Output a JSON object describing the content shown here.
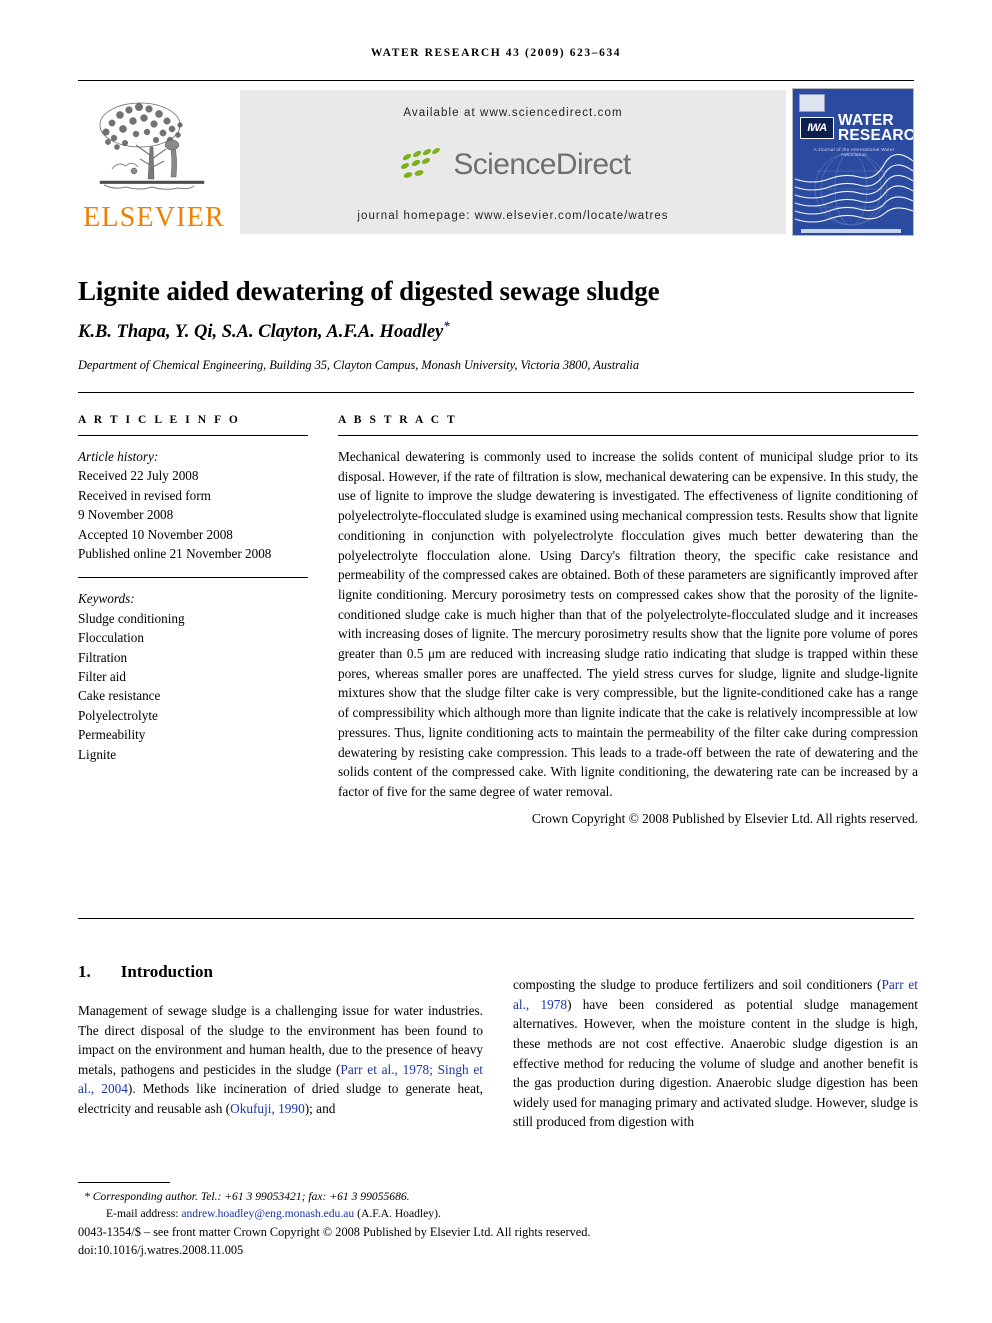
{
  "running_head": "WATER RESEARCH 43 (2009) 623–634",
  "masthead": {
    "elsevier_wordmark": "ELSEVIER",
    "available_at": "Available at www.sciencedirect.com",
    "sciencedirect_wordmark": "ScienceDirect",
    "journal_homepage": "journal homepage: www.elsevier.com/locate/watres",
    "cover": {
      "iwa_logo_text": "IWA",
      "title_line1": "WATER",
      "title_line2": "RESEARCH",
      "tagline": "A Journal of the International Water Association"
    },
    "colors": {
      "elsevier_orange": "#f08000",
      "sciencedirect_green": "#7ab317",
      "sciencedirect_gray": "#6f6f6f",
      "cover_blue": "#2b4ba0"
    }
  },
  "article": {
    "title": "Lignite aided dewatering of digested sewage sludge",
    "authors": "K.B. Thapa, Y. Qi, S.A. Clayton, A.F.A. Hoadley",
    "corresponding_marker": "*",
    "affiliation": "Department of Chemical Engineering, Building 35, Clayton Campus, Monash University, Victoria 3800, Australia"
  },
  "article_info": {
    "heading": "A R T I C L E   I N F O",
    "history_label": "Article history:",
    "history": [
      "Received 22 July 2008",
      "Received in revised form",
      "9 November 2008",
      "Accepted 10 November 2008",
      "Published online 21 November 2008"
    ],
    "keywords_label": "Keywords:",
    "keywords": [
      "Sludge conditioning",
      "Flocculation",
      "Filtration",
      "Filter aid",
      "Cake resistance",
      "Polyelectrolyte",
      "Permeability",
      "Lignite"
    ]
  },
  "abstract": {
    "heading": "A B S T R A C T",
    "text": "Mechanical dewatering is commonly used to increase the solids content of municipal sludge prior to its disposal. However, if the rate of filtration is slow, mechanical dewatering can be expensive. In this study, the use of lignite to improve the sludge dewatering is investigated. The effectiveness of lignite conditioning of polyelectrolyte-flocculated sludge is examined using mechanical compression tests. Results show that lignite conditioning in conjunction with polyelectrolyte flocculation gives much better dewatering than the polyelectrolyte flocculation alone. Using Darcy's filtration theory, the specific cake resistance and permeability of the compressed cakes are obtained. Both of these parameters are significantly improved after lignite conditioning. Mercury porosimetry tests on compressed cakes show that the porosity of the lignite-conditioned sludge cake is much higher than that of the polyelectrolyte-flocculated sludge and it increases with increasing doses of lignite. The mercury porosimetry results show that the lignite pore volume of pores greater than 0.5 μm are reduced with increasing sludge ratio indicating that sludge is trapped within these pores, whereas smaller pores are unaffected. The yield stress curves for sludge, lignite and sludge-lignite mixtures show that the sludge filter cake is very compressible, but the lignite-conditioned cake has a range of compressibility which although more than lignite indicate that the cake is relatively incompressible at low pressures. Thus, lignite conditioning acts to maintain the permeability of the filter cake during compression dewatering by resisting cake compression. This leads to a trade-off between the rate of dewatering and the solids content of the compressed cake. With lignite conditioning, the dewatering rate can be increased by a factor of five for the same degree of water removal.",
    "copyright": "Crown Copyright © 2008 Published by Elsevier Ltd. All rights reserved."
  },
  "introduction": {
    "number": "1.",
    "heading": "Introduction",
    "left_column_parts": {
      "p1a": "Management of sewage sludge is a challenging issue for water industries. The direct disposal of the sludge to the environment has been found to impact on the environment and human health, due to the presence of heavy metals, pathogens and pesticides in the sludge (",
      "cite1": "Parr et al., 1978; Singh et al., 2004",
      "p1b": "). Methods like incineration of dried sludge to generate heat, electricity and reusable ash (",
      "cite2": "Okufuji, 1990",
      "p1c": "); and"
    },
    "right_column_parts": {
      "p2a": "composting the sludge to produce fertilizers and soil conditioners (",
      "cite3": "Parr et al., 1978",
      "p2b": ") have been considered as potential sludge management alternatives. However, when the moisture content in the sludge is high, these methods are not cost effective. Anaerobic sludge digestion is an effective method for reducing the volume of sludge and another benefit is the gas production during digestion. Anaerobic sludge digestion has been widely used for managing primary and activated sludge. However, sludge is still produced from digestion with"
    }
  },
  "footer": {
    "corresponding_marker": "*",
    "corresponding": "Corresponding author. Tel.: +61 3 99053421; fax: +61 3 99055686.",
    "email_label": "E-mail address:",
    "email": "andrew.hoadley@eng.monash.edu.au",
    "email_owner": "(A.F.A. Hoadley).",
    "issn_line": "0043-1354/$ – see front matter Crown Copyright © 2008 Published by Elsevier Ltd. All rights reserved.",
    "doi": "doi:10.1016/j.watres.2008.11.005"
  }
}
